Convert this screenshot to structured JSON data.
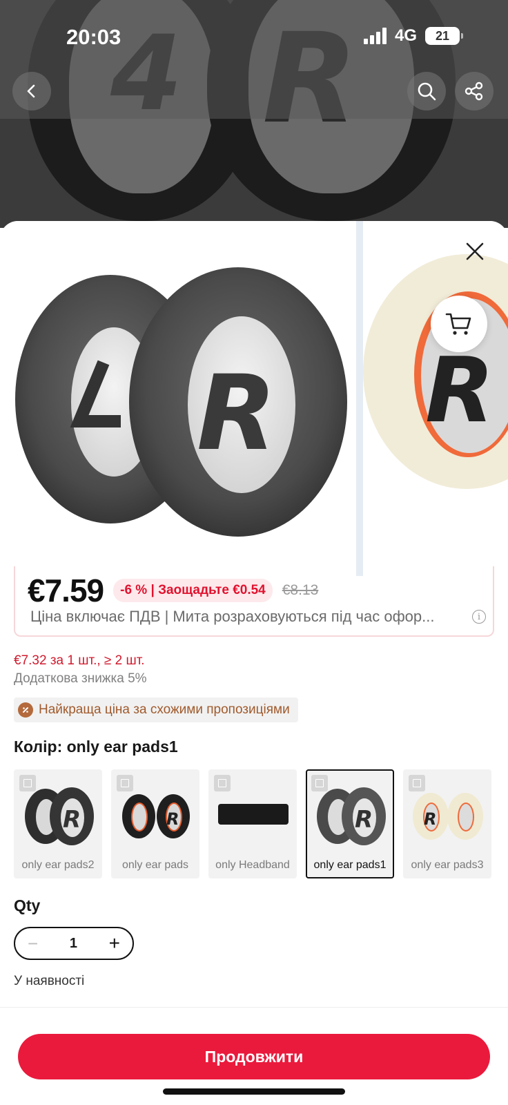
{
  "status_bar": {
    "time": "20:03",
    "network": "4G",
    "battery": "21"
  },
  "backdrop": {
    "letters": [
      "4",
      "R"
    ]
  },
  "product": {
    "price": "€7.59",
    "discount": "-6 % | Заощадьте €0.54",
    "old_price": "€8.13",
    "vat_note": "Ціна включає ПДВ | Мита розраховуються під час офор...",
    "bulk_price": "€7.32 за 1 шт., ≥ 2 шт.",
    "extra_discount": "Додаткова знижка 5%",
    "best_price_badge": "Найкраща ціна за схожими пропозиціями"
  },
  "color": {
    "title": "Колір: only ear pads1",
    "variants": [
      {
        "label": "only ear pads2",
        "selected": false
      },
      {
        "label": "only ear pads",
        "selected": false
      },
      {
        "label": "only Headband",
        "selected": false
      },
      {
        "label": "only ear pads1",
        "selected": true
      },
      {
        "label": "only ear pads3",
        "selected": false
      }
    ]
  },
  "quantity": {
    "title": "Qty",
    "value": "1",
    "minus": "−",
    "plus": "+"
  },
  "stock_status": "У наявності",
  "continue_button": "Продовжити",
  "colors": {
    "accent": "#ea1a3c",
    "price_red": "#d01a2d"
  }
}
